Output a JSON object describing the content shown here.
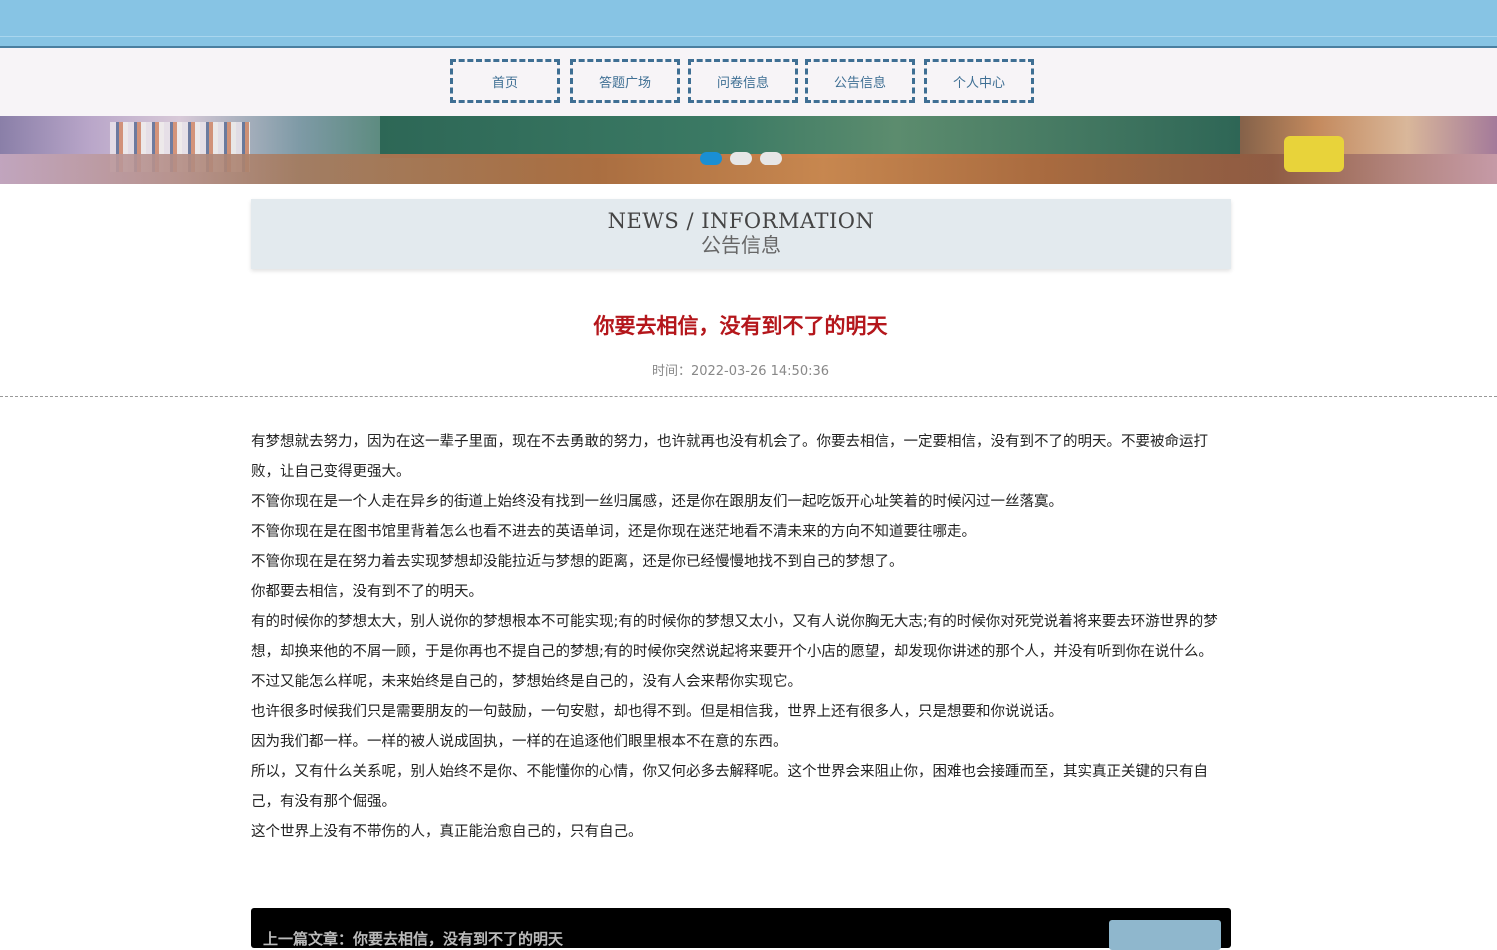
{
  "nav": {
    "items": [
      {
        "label": "首页"
      },
      {
        "label": "答题广场"
      },
      {
        "label": "问卷信息"
      },
      {
        "label": "公告信息"
      },
      {
        "label": "个人中心"
      }
    ]
  },
  "banner": {
    "slide_count": 3,
    "active_slide": 1
  },
  "section": {
    "title_en": "NEWS / INFORMATION",
    "title_cn": "公告信息"
  },
  "article": {
    "title": "你要去相信，没有到不了的明天",
    "time": "时间：2022-03-26 14:50:36",
    "paragraphs": [
      "有梦想就去努力，因为在这一辈子里面，现在不去勇敢的努力，也许就再也没有机会了。你要去相信，一定要相信，没有到不了的明天。不要被命运打败，让自己变得更强大。",
      "不管你现在是一个人走在异乡的街道上始终没有找到一丝归属感，还是你在跟朋友们一起吃饭开心址笑着的时候闪过一丝落寞。",
      "不管你现在是在图书馆里背着怎么也看不进去的英语单词，还是你现在迷茫地看不清未来的方向不知道要往哪走。",
      "不管你现在是在努力着去实现梦想却没能拉近与梦想的距离，还是你已经慢慢地找不到自己的梦想了。",
      "你都要去相信，没有到不了的明天。",
      "有的时候你的梦想太大，别人说你的梦想根本不可能实现;有的时候你的梦想又太小，又有人说你胸无大志;有的时候你对死党说着将来要去环游世界的梦想，却换来他的不屑一顾，于是你再也不提自己的梦想;有的时候你突然说起将来要开个小店的愿望，却发现你讲述的那个人，并没有听到你在说什么。",
      "不过又能怎么样呢，未来始终是自己的，梦想始终是自己的，没有人会来帮你实现它。",
      "也许很多时候我们只是需要朋友的一句鼓励，一句安慰，却也得不到。但是相信我，世界上还有很多人，只是想要和你说说话。",
      "因为我们都一样。一样的被人说成固执，一样的在追逐他们眼里根本不在意的东西。",
      "所以，又有什么关系呢，别人始终不是你、不能懂你的心情，你又何必多去解释呢。这个世界会来阻止你，困难也会接踵而至，其实真正关键的只有自己，有没有那个倔强。",
      "这个世界上没有不带伤的人，真正能治愈自己的，只有自己。"
    ]
  },
  "footer": {
    "prev_label": "上一篇文章：你要去相信，没有到不了的明天"
  },
  "colors": {
    "topbar": "#87c4e4",
    "nav_border": "#3f6f94",
    "title_red": "#b4161b",
    "dot_active": "#1a8fd4"
  }
}
